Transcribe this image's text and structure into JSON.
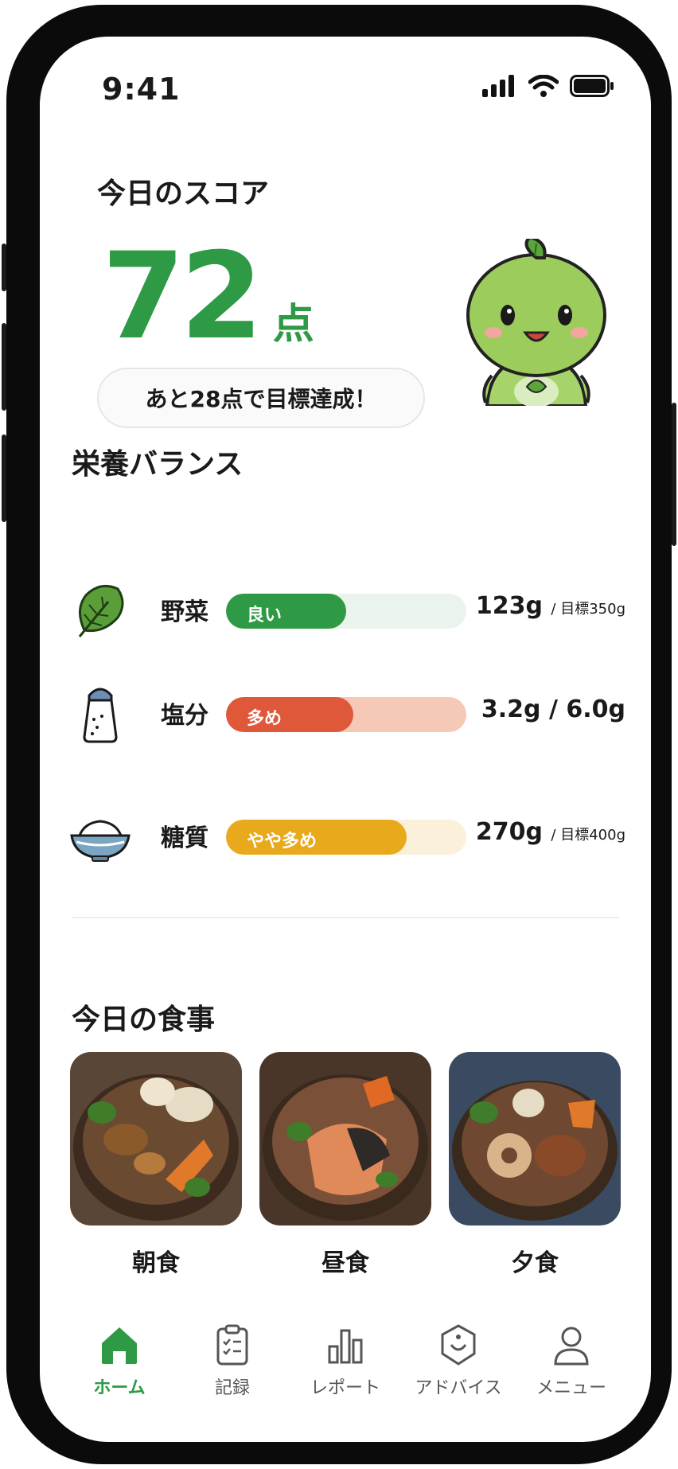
{
  "status_bar": {
    "time": "9:41"
  },
  "score": {
    "title": "今日のスコア",
    "value": "72",
    "unit": "点",
    "goal_message": "あと28点で目標達成！"
  },
  "nutrition": {
    "title": "栄養バランス",
    "items": [
      {
        "name": "野菜",
        "status": "良い",
        "level": 0.5,
        "value": "123g",
        "target": "/ 目標350g",
        "color": "#2e9a45",
        "track_color": "#eaf4ec",
        "icon": "leafy-greens-icon"
      },
      {
        "name": "塩分",
        "status": "多め",
        "level": 0.53,
        "value": "3.2g / 6.0g",
        "target": "",
        "color": "#e0583a",
        "track_color": "#f6c8b6",
        "icon": "salt-shaker-icon"
      },
      {
        "name": "糖質",
        "status": "やや多め",
        "level": 0.75,
        "value": "270g",
        "target": "/ 目標400g",
        "color": "#e8a91c",
        "track_color": "#fbf0d9",
        "icon": "rice-bowl-icon"
      }
    ]
  },
  "meals": {
    "title": "今日の食事",
    "items": [
      {
        "label": "朝食"
      },
      {
        "label": "昼食"
      },
      {
        "label": "夕食"
      }
    ]
  },
  "nav": {
    "items": [
      {
        "label": "ホーム",
        "icon": "home-icon",
        "active": true
      },
      {
        "label": "記録",
        "icon": "clipboard-icon",
        "active": false
      },
      {
        "label": "レポート",
        "icon": "bar-chart-icon",
        "active": false
      },
      {
        "label": "アドバイス",
        "icon": "advice-icon",
        "active": false
      },
      {
        "label": "メニュー",
        "icon": "user-icon",
        "active": false
      }
    ],
    "accent": "#2e9a45"
  }
}
